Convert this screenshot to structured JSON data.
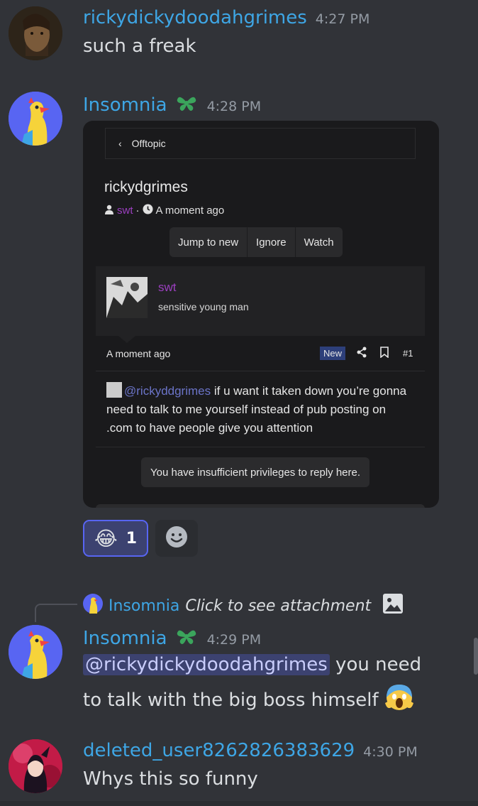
{
  "messages": [
    {
      "username": "rickydickydoodahgrimes",
      "time": "4:27 PM",
      "text": "such a freak"
    },
    {
      "username": "Insomnia",
      "time": "4:28 PM"
    },
    {
      "username": "Insomnia",
      "time": "4:29 PM",
      "mention": "@rickydickydoodahgrimes",
      "text_after_mention": " you need",
      "text_line2": "to talk with the big boss himself"
    },
    {
      "username": "deleted_user8262826383629",
      "time": "4:30 PM",
      "text": "Whys this so funny"
    }
  ],
  "embed": {
    "breadcrumb": "Offtopic",
    "thread_title": "rickydgrimes",
    "author": "swt",
    "meta_separator": "·",
    "posted": "A moment ago",
    "buttons": [
      "Jump to new",
      "Ignore",
      "Watch"
    ],
    "user_name": "swt",
    "user_bio": "sensitive young man",
    "post_time": "A moment ago",
    "new_badge": "New",
    "post_number": "#1",
    "post_mention": "@rickyddgrimes",
    "post_body": " if u want it taken down you’re gonna need to talk to me yourself instead of pub posting on .com to have people give you attention",
    "notice": "You have insufficient privileges to reply here."
  },
  "reaction": {
    "emoji": "😂",
    "count": "1"
  },
  "reply_preview": {
    "username": "Insomnia",
    "text": "Click to see attachment"
  },
  "icons": [
    "clover-badge-icon",
    "add-reaction-icon",
    "image-icon",
    "share-icon",
    "bookmark-icon"
  ],
  "colors": {
    "username": "#3ea6e5",
    "background": "#313338",
    "accent": "#5865f2"
  }
}
